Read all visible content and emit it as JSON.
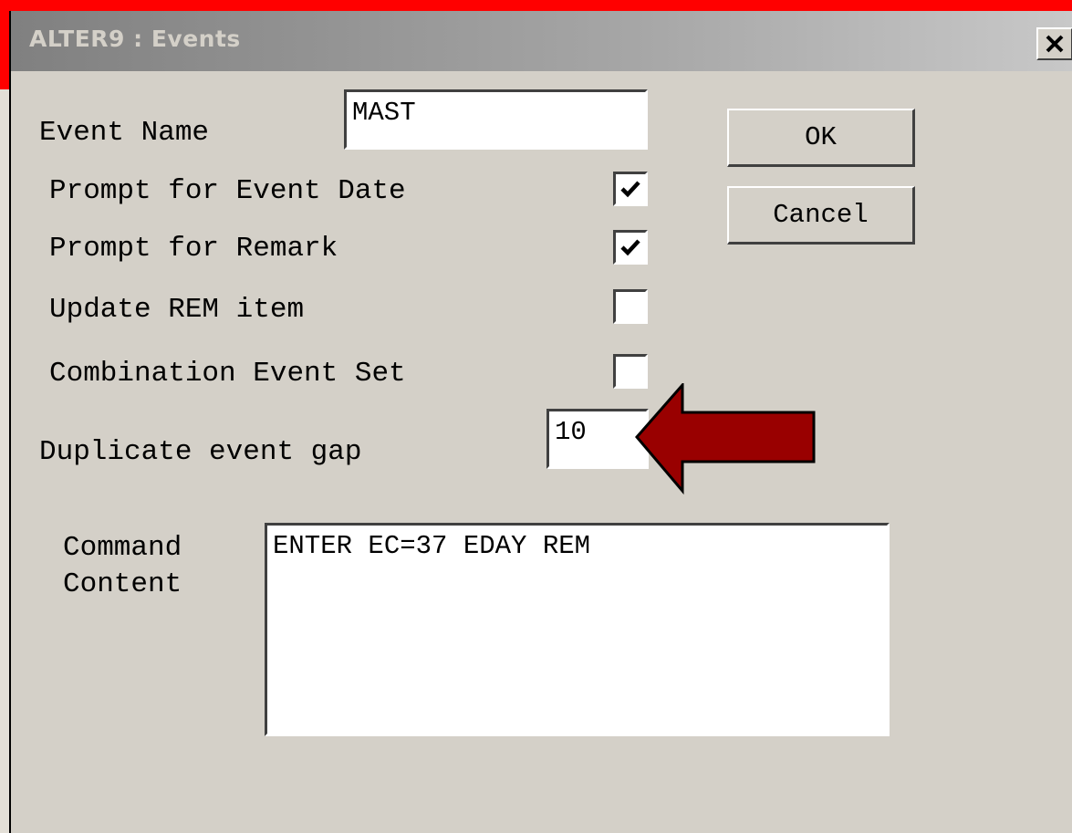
{
  "window": {
    "title": "ALTER9 : Events",
    "close_glyph": "✕"
  },
  "form": {
    "event_name_label": "Event Name",
    "event_name_value": "MAST",
    "prompt_event_date_label": "Prompt for Event Date",
    "prompt_event_date_checked": true,
    "prompt_remark_label": "Prompt for Remark",
    "prompt_remark_checked": true,
    "update_rem_label": "Update REM item",
    "update_rem_checked": false,
    "combination_label": "Combination Event Set",
    "combination_checked": false,
    "duplicate_gap_label": "Duplicate event gap",
    "duplicate_gap_value": "10",
    "command_content_label_line1": "Command",
    "command_content_label_line2": "Content",
    "command_content_value": "ENTER EC=37 EDAY REM"
  },
  "buttons": {
    "ok": "OK",
    "cancel": "Cancel"
  },
  "colors": {
    "annotation_arrow": "#990000",
    "highlight_frame": "#ff0000"
  }
}
